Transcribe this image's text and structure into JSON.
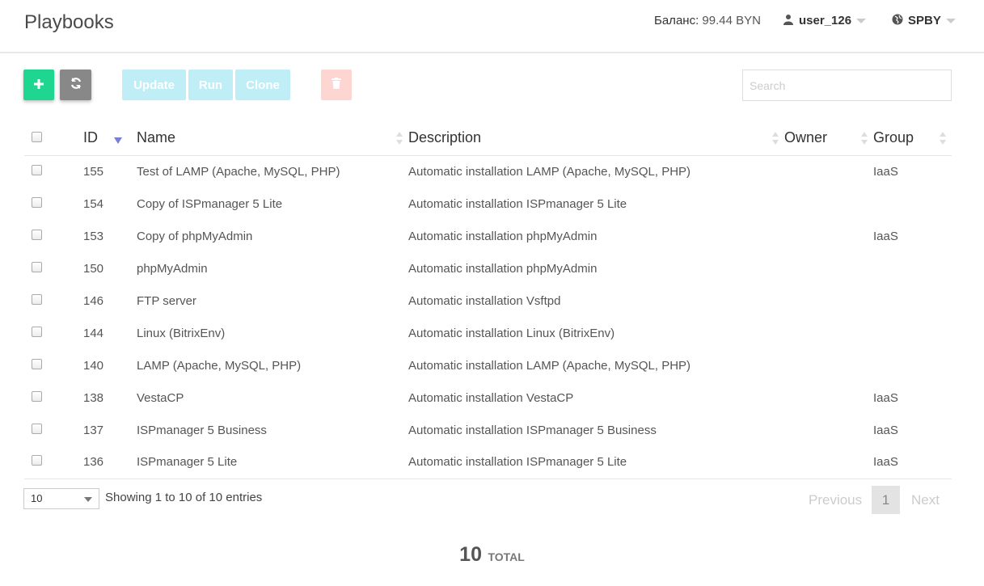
{
  "header": {
    "title": "Playbooks",
    "balance_label": "Баланс:",
    "balance_value": "99.44 BYN",
    "user": "user_126",
    "region": "SPBY"
  },
  "toolbar": {
    "add_icon": "plus-icon",
    "refresh_icon": "refresh-icon",
    "update_label": "Update",
    "run_label": "Run",
    "clone_label": "Clone",
    "delete_icon": "trash-icon",
    "search_placeholder": "Search"
  },
  "table": {
    "columns": [
      "ID",
      "Name",
      "Description",
      "Owner",
      "Group"
    ],
    "rows": [
      {
        "id": "155",
        "name": "Test of LAMP (Apache, MySQL, PHP)",
        "description": "Automatic installation LAMP (Apache, MySQL, PHP)",
        "owner": "",
        "group": "IaaS"
      },
      {
        "id": "154",
        "name": "Copy of ISPmanager 5 Lite",
        "description": "Automatic installation ISPmanager 5 Lite",
        "owner": "",
        "group": ""
      },
      {
        "id": "153",
        "name": "Copy of phpMyAdmin",
        "description": "Automatic installation phpMyAdmin",
        "owner": "",
        "group": "IaaS"
      },
      {
        "id": "150",
        "name": "phpMyAdmin",
        "description": "Automatic installation phpMyAdmin",
        "owner": "",
        "group": ""
      },
      {
        "id": "146",
        "name": "FTP server",
        "description": "Automatic installation Vsftpd",
        "owner": "",
        "group": ""
      },
      {
        "id": "144",
        "name": "Linux (BitrixEnv)",
        "description": "Automatic installation Linux (BitrixEnv)",
        "owner": "",
        "group": ""
      },
      {
        "id": "140",
        "name": "LAMP (Apache, MySQL, PHP)",
        "description": "Automatic installation LAMP (Apache, MySQL, PHP)",
        "owner": "",
        "group": ""
      },
      {
        "id": "138",
        "name": "VestaCP",
        "description": "Automatic installation VestaCP",
        "owner": "",
        "group": "IaaS"
      },
      {
        "id": "137",
        "name": "ISPmanager 5 Business",
        "description": "Automatic installation ISPmanager 5 Business",
        "owner": "",
        "group": "IaaS"
      },
      {
        "id": "136",
        "name": "ISPmanager 5 Lite",
        "description": "Automatic installation ISPmanager 5 Lite",
        "owner": "",
        "group": "IaaS"
      }
    ]
  },
  "footer": {
    "page_length": "10",
    "info": "Showing 1 to 10 of 10 entries",
    "previous": "Previous",
    "current_page": "1",
    "next": "Next",
    "total_count": "10",
    "total_label": "TOTAL"
  },
  "colors": {
    "add_button": "#1ed68f",
    "refresh_button": "#888888",
    "action_buttons_disabled": "#bfeef7",
    "delete_button_disabled": "#fdd6d2",
    "sort_active": "#7a7fd6"
  }
}
